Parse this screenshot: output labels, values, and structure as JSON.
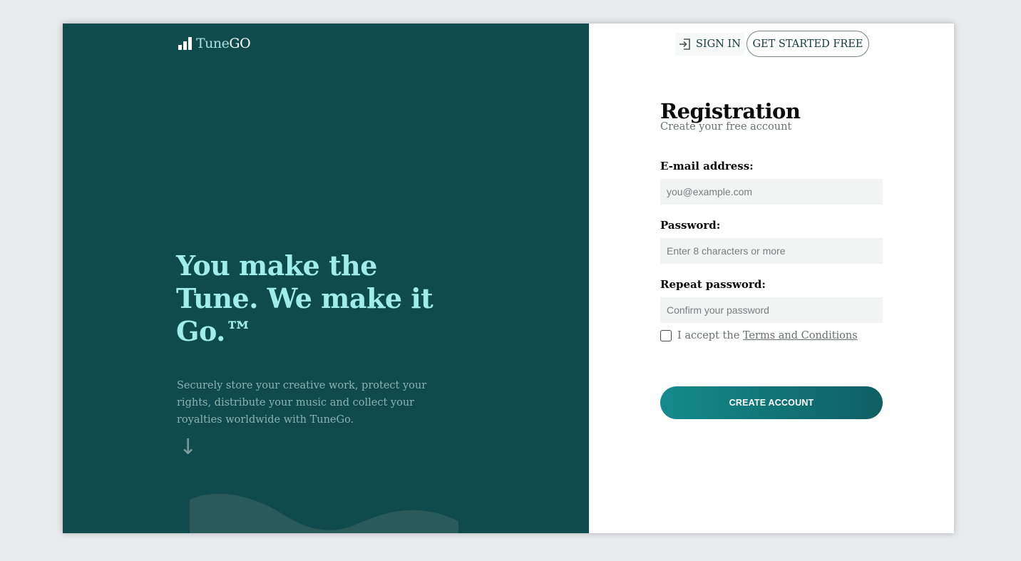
{
  "brand": {
    "name_part1": "Tune",
    "name_part2": "GO"
  },
  "hero": {
    "headline": "You make the Tune. We make it Go.™",
    "description": "Securely store your creative work, protect your rights, distribute your music and collect your royalties worldwide with TuneGo.",
    "arrow": "↓"
  },
  "header": {
    "sign_in_label": "SIGN IN",
    "get_started_label": "GET STARTED FREE"
  },
  "form": {
    "title": "Registration",
    "subtitle": "Create your free account",
    "email": {
      "label": "E-mail address:",
      "placeholder": "you@example.com",
      "value": ""
    },
    "password": {
      "label": "Password:",
      "placeholder": "Enter 8 characters or more",
      "value": ""
    },
    "repeat_password": {
      "label": "Repeat password:",
      "placeholder": "Confirm your password",
      "value": ""
    },
    "terms": {
      "prefix": "I accept the ",
      "link_text": "Terms and Conditions",
      "checked": false
    },
    "submit_label": "CREATE ACCOUNT"
  },
  "colors": {
    "left_panel_bg": "#0f4a4c",
    "headline": "#9fecea",
    "button_gradient_start": "#148a8c",
    "button_gradient_end": "#0f5f62"
  },
  "icons": {
    "sign_in": "sign-in-icon",
    "logo": "bar-chart-icon",
    "scroll": "arrow-down-icon"
  }
}
